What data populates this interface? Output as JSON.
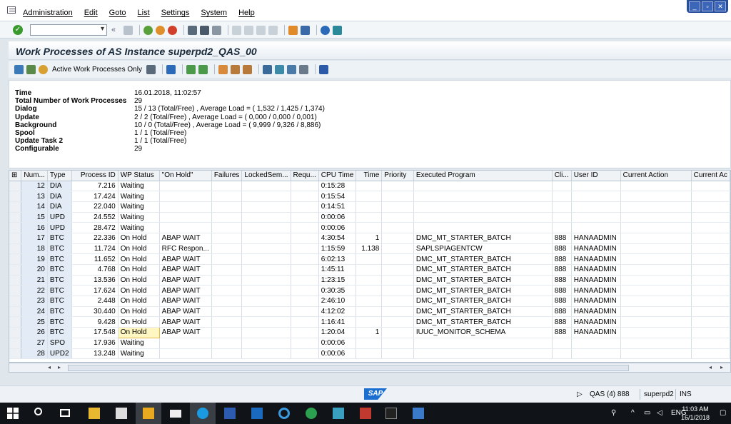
{
  "menu": [
    "Administration",
    "Edit",
    "Goto",
    "List",
    "Settings",
    "System",
    "Help"
  ],
  "window_controls": [
    "_",
    "▫",
    "✕"
  ],
  "title": "Work Processes of AS Instance superpd2_QAS_00",
  "app_toolbar": {
    "active_wp_label": "Active Work Processes Only"
  },
  "info": [
    {
      "key": "Time",
      "value": "16.01.2018, 11:02:57"
    },
    {
      "key": "Total Number of Work Processes",
      "value": "29"
    },
    {
      "key": "Dialog",
      "value": "15 / 13 (Total/Free) , Average Load = ( 1,532 / 1,425 / 1,374)"
    },
    {
      "key": "Update",
      "value": "2 / 2 (Total/Free) , Average Load = ( 0,000 / 0,000 / 0,001)"
    },
    {
      "key": "Background",
      "value": "10 / 0 (Total/Free) , Average Load = ( 9,999 / 9,326 / 8,886)"
    },
    {
      "key": "Spool",
      "value": "1 / 1 (Total/Free)"
    },
    {
      "key": "Update Task 2",
      "value": "1 / 1 (Total/Free)"
    },
    {
      "key": "Configurable",
      "value": "29"
    }
  ],
  "table": {
    "columns": [
      "Num...",
      "Type",
      "Process ID",
      "WP Status",
      "\"On Hold\"",
      "Failures",
      "LockedSem...",
      "Requ...",
      "CPU Time",
      "Time",
      "Priority",
      "Executed Program",
      "Cli...",
      "User ID",
      "Current Action",
      "Current Ac"
    ],
    "rows": [
      [
        "12",
        "DIA",
        "7.216",
        "Waiting",
        "",
        "",
        "",
        "",
        "0:15:28",
        "",
        "",
        "",
        "",
        "",
        "",
        ""
      ],
      [
        "13",
        "DIA",
        "17.424",
        "Waiting",
        "",
        "",
        "",
        "",
        "0:15:54",
        "",
        "",
        "",
        "",
        "",
        "",
        ""
      ],
      [
        "14",
        "DIA",
        "22.040",
        "Waiting",
        "",
        "",
        "",
        "",
        "0:14:51",
        "",
        "",
        "",
        "",
        "",
        "",
        ""
      ],
      [
        "15",
        "UPD",
        "24.552",
        "Waiting",
        "",
        "",
        "",
        "",
        "0:00:06",
        "",
        "",
        "",
        "",
        "",
        "",
        ""
      ],
      [
        "16",
        "UPD",
        "28.472",
        "Waiting",
        "",
        "",
        "",
        "",
        "0:00:06",
        "",
        "",
        "",
        "",
        "",
        "",
        ""
      ],
      [
        "17",
        "BTC",
        "22.336",
        "On Hold",
        "ABAP WAIT",
        "",
        "",
        "",
        "4:30:54",
        "1",
        "",
        "DMC_MT_STARTER_BATCH",
        "888",
        "HANAADMIN",
        "",
        ""
      ],
      [
        "18",
        "BTC",
        "11.724",
        "On Hold",
        "RFC Respon...",
        "",
        "",
        "",
        "1:15:59",
        "1.138",
        "",
        "SAPLSPIAGENTCW",
        "888",
        "HANAADMIN",
        "",
        ""
      ],
      [
        "19",
        "BTC",
        "11.652",
        "On Hold",
        "ABAP WAIT",
        "",
        "",
        "",
        "6:02:13",
        "",
        "",
        "DMC_MT_STARTER_BATCH",
        "888",
        "HANAADMIN",
        "",
        ""
      ],
      [
        "20",
        "BTC",
        "4.768",
        "On Hold",
        "ABAP WAIT",
        "",
        "",
        "",
        "1:45:11",
        "",
        "",
        "DMC_MT_STARTER_BATCH",
        "888",
        "HANAADMIN",
        "",
        ""
      ],
      [
        "21",
        "BTC",
        "13.536",
        "On Hold",
        "ABAP WAIT",
        "",
        "",
        "",
        "1:23:15",
        "",
        "",
        "DMC_MT_STARTER_BATCH",
        "888",
        "HANAADMIN",
        "",
        ""
      ],
      [
        "22",
        "BTC",
        "17.624",
        "On Hold",
        "ABAP WAIT",
        "",
        "",
        "",
        "0:30:35",
        "",
        "",
        "DMC_MT_STARTER_BATCH",
        "888",
        "HANAADMIN",
        "",
        ""
      ],
      [
        "23",
        "BTC",
        "2.448",
        "On Hold",
        "ABAP WAIT",
        "",
        "",
        "",
        "2:46:10",
        "",
        "",
        "DMC_MT_STARTER_BATCH",
        "888",
        "HANAADMIN",
        "",
        ""
      ],
      [
        "24",
        "BTC",
        "30.440",
        "On Hold",
        "ABAP WAIT",
        "",
        "",
        "",
        "4:12:02",
        "",
        "",
        "DMC_MT_STARTER_BATCH",
        "888",
        "HANAADMIN",
        "",
        ""
      ],
      [
        "25",
        "BTC",
        "9.428",
        "On Hold",
        "ABAP WAIT",
        "",
        "",
        "",
        "1:16:41",
        "",
        "",
        "DMC_MT_STARTER_BATCH",
        "888",
        "HANAADMIN",
        "",
        ""
      ],
      [
        "26",
        "BTC",
        "17.548",
        "On Hold",
        "ABAP WAIT",
        "",
        "",
        "",
        "1:20:04",
        "1",
        "",
        "IUUC_MONITOR_SCHEMA",
        "888",
        "HANAADMIN",
        "",
        ""
      ],
      [
        "27",
        "SPO",
        "17.936",
        "Waiting",
        "",
        "",
        "",
        "",
        "0:00:06",
        "",
        "",
        "",
        "",
        "",
        "",
        ""
      ],
      [
        "28",
        "UPD2",
        "13.248",
        "Waiting",
        "",
        "",
        "",
        "",
        "0:00:06",
        "",
        "",
        "",
        "",
        "",
        "",
        ""
      ]
    ]
  },
  "status": {
    "logo": "SAP",
    "system": "QAS (4) 888",
    "server": "superpd2",
    "mode": "INS"
  },
  "taskbar": {
    "lang": "ENG",
    "time": "11:03 AM",
    "date": "16/1/2018"
  },
  "colors": {
    "highlight_cell": "#fff7c2",
    "key_column": "#e3ecf6",
    "taskbar": "#101418"
  }
}
